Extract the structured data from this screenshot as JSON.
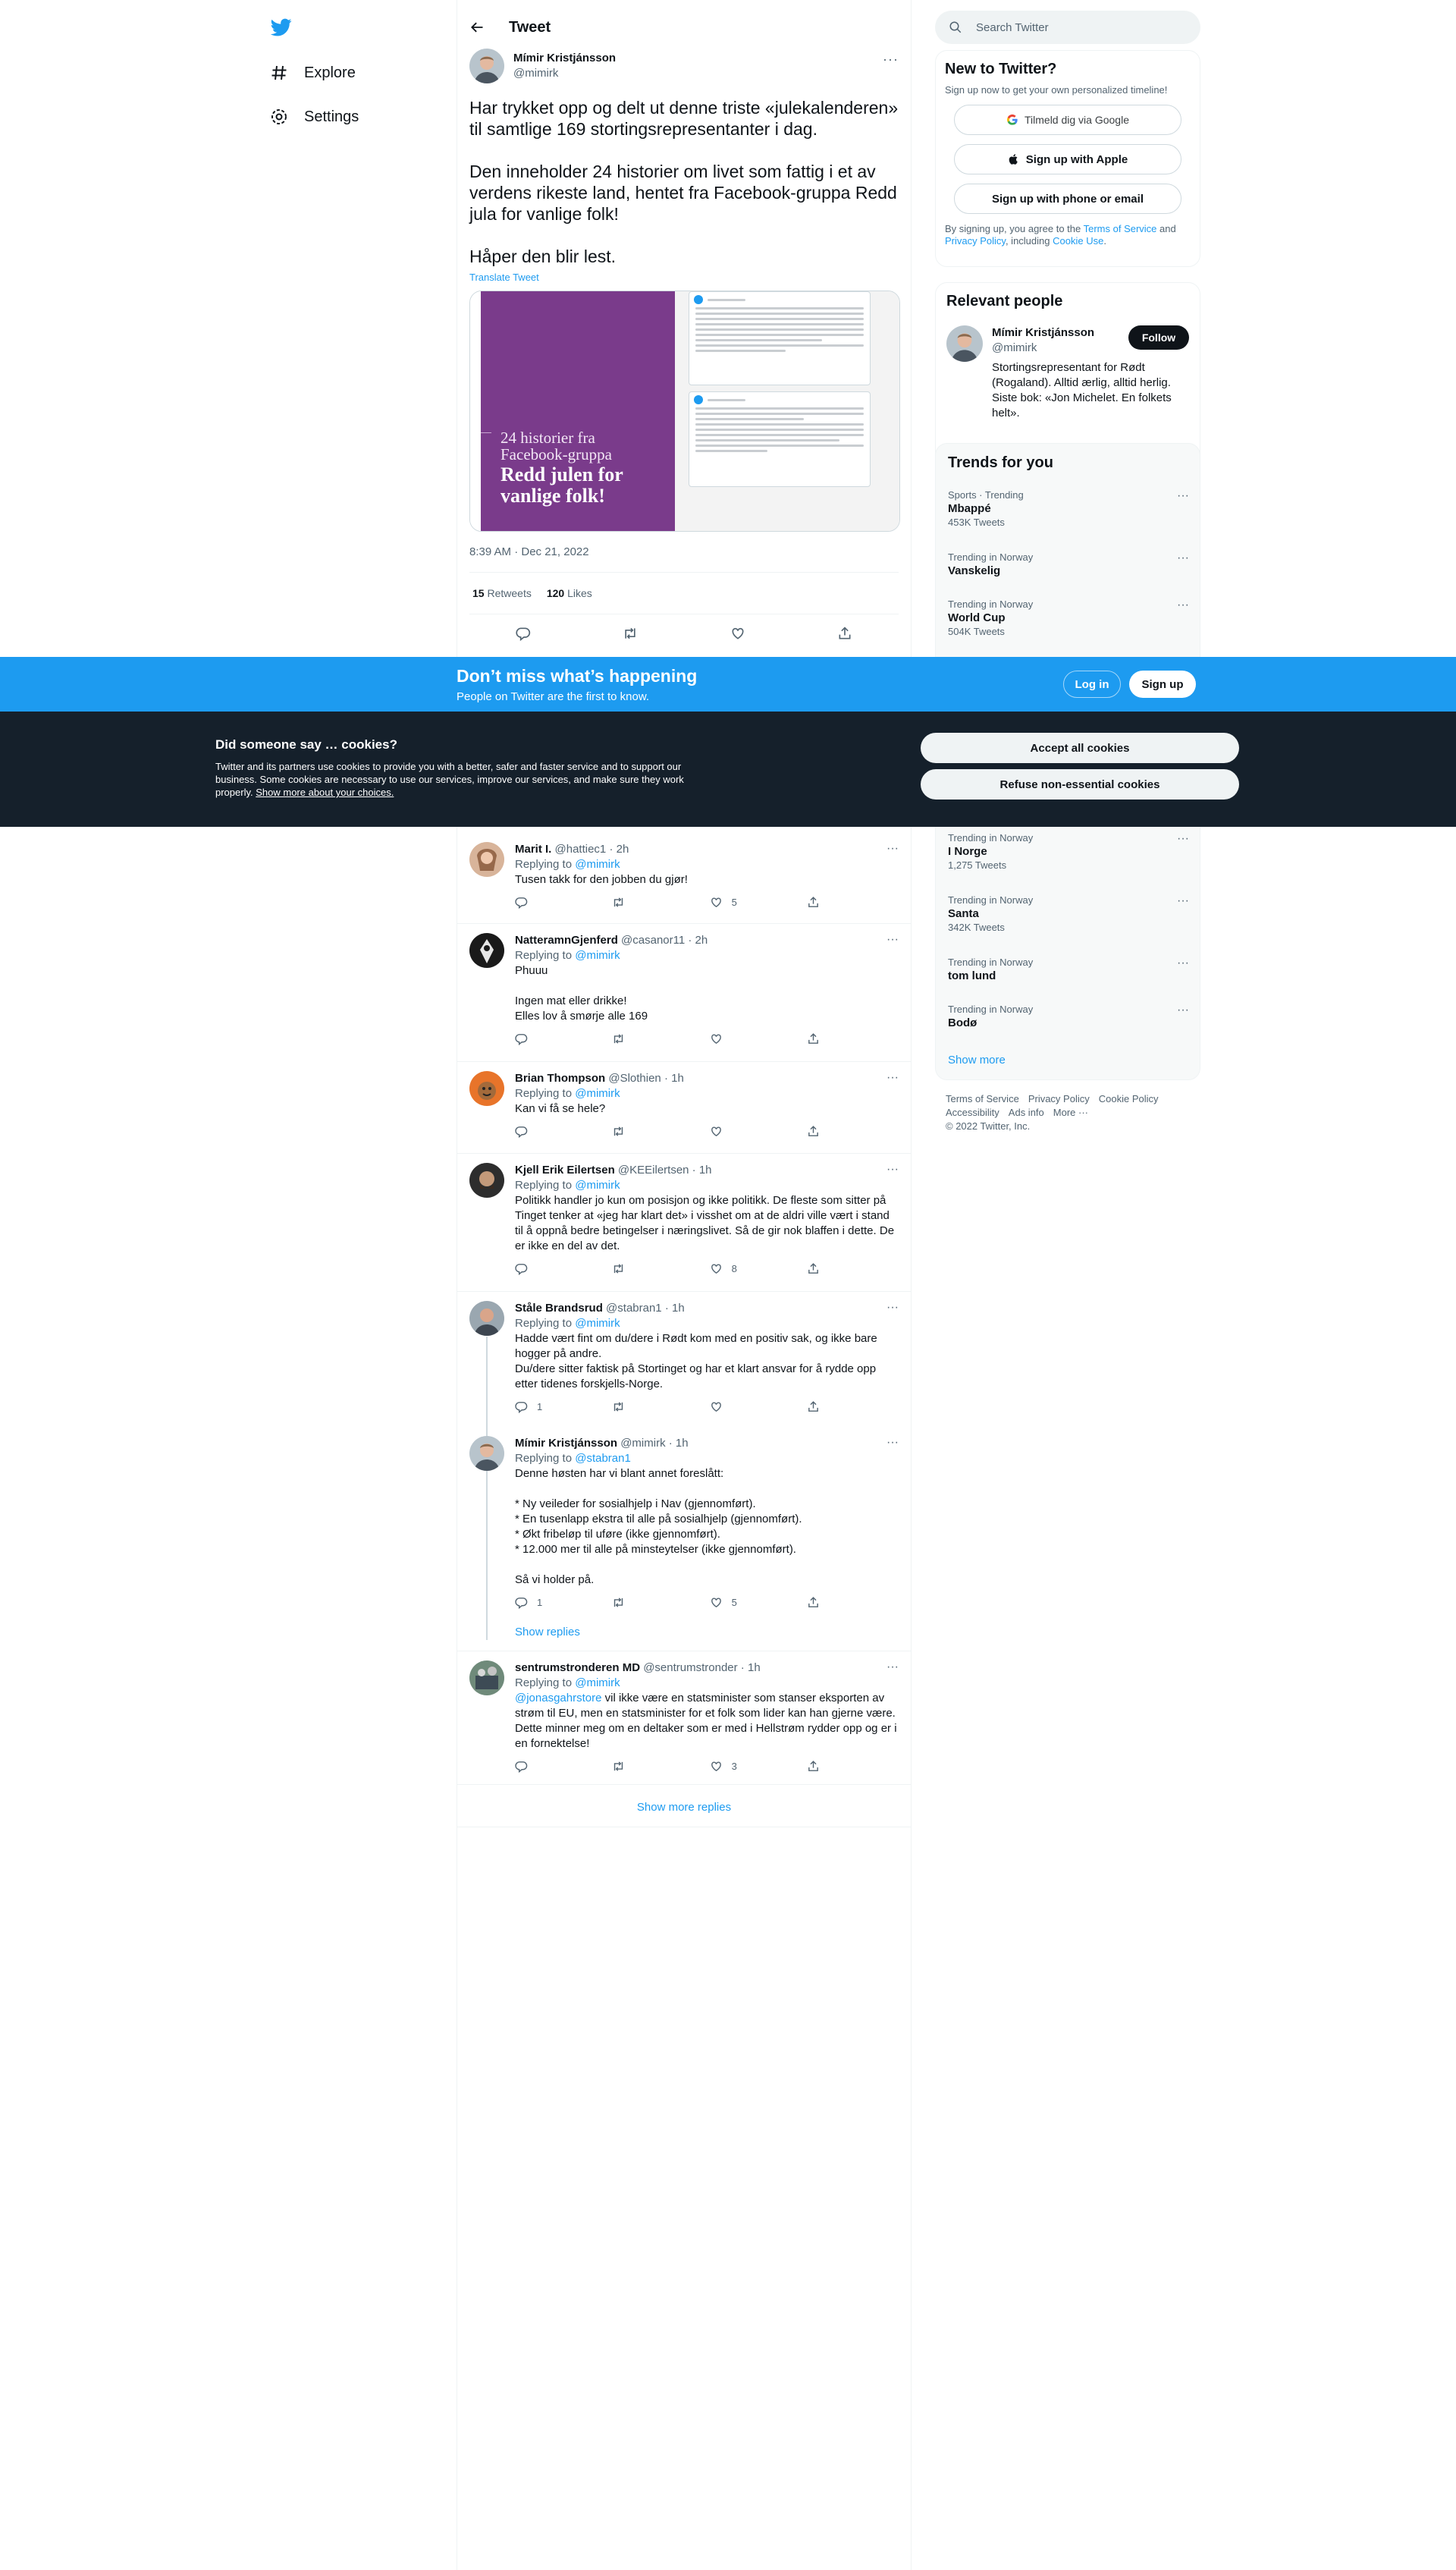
{
  "nav": {
    "logo": "twitter-bird",
    "items": [
      {
        "label": "Explore",
        "icon": "hashtag-icon"
      },
      {
        "label": "Settings",
        "icon": "gear-icon"
      }
    ]
  },
  "header": {
    "title": "Tweet"
  },
  "main_tweet": {
    "author_name": "Mímir Kristjánsson",
    "author_handle": "@mimirk",
    "paragraphs": [
      "Har trykket opp og delt ut denne triste «julekalenderen» til samtlige 169 stortingsrepresentanter i dag.",
      "Den inneholder 24 historier om livet som fattig i et av verdens rikeste land, hentet fra Facebook-gruppa Redd jula for vanlige folk!",
      "Håper den blir lest."
    ],
    "translate": "Translate Tweet",
    "media_sub_line1": "24 historier fra",
    "media_sub_line2": "Facebook-gruppa",
    "media_big_line1": "Redd julen for",
    "media_big_line2": "vanlige folk!",
    "timestamp": "8:39 AM · Dec 21, 2022",
    "retweets_count": "15",
    "retweets_label": "Retweets",
    "likes_count": "120",
    "likes_label": "Likes"
  },
  "replies": [
    {
      "name": "Marit I.",
      "handle": "@hattiec1 · 2h",
      "replying_label": "Replying to",
      "replying_to": "@mimirk",
      "text": "Tusen takk for den jobben du gjør!",
      "reply_count": "",
      "retweet_count": "",
      "like_count": "5"
    },
    {
      "name": "NatteramnGjenferd",
      "handle": "@casanor11 · 2h",
      "replying_label": "Replying to",
      "replying_to": "@mimirk",
      "text": "Phuuu\n\nIngen mat eller drikke!\nElles lov å smørje alle 169",
      "reply_count": "",
      "retweet_count": "",
      "like_count": ""
    },
    {
      "name": "Brian Thompson",
      "handle": "@Slothien · 1h",
      "replying_label": "Replying to",
      "replying_to": "@mimirk",
      "text": "Kan vi få se hele?",
      "reply_count": "",
      "retweet_count": "",
      "like_count": ""
    },
    {
      "name": "Kjell Erik Eilertsen",
      "handle": "@KEEilertsen · 1h",
      "replying_label": "Replying to",
      "replying_to": "@mimirk",
      "text": "Politikk handler jo kun om posisjon og ikke politikk. De fleste som sitter på Tinget tenker at «jeg har klart det» i visshet om at de aldri ville vært i stand til å oppnå bedre betingelser i næringslivet. Så de gir nok blaffen i dette. De er ikke en del av det.",
      "reply_count": "",
      "retweet_count": "",
      "like_count": "8"
    },
    {
      "name": "Ståle Brandsrud",
      "handle": "@stabran1 · 1h",
      "replying_label": "Replying to",
      "replying_to": "@mimirk",
      "text": "Hadde vært fint om du/dere i Rødt kom med en positiv sak, og ikke bare hogger på andre.\nDu/dere sitter faktisk på Stortinget og har et klart ansvar for å rydde opp etter tidenes forskjells-Norge.",
      "reply_count": "1",
      "retweet_count": "",
      "like_count": ""
    },
    {
      "name": "Mímir Kristjánsson",
      "handle": "@mimirk · 1h",
      "replying_label": "Replying to",
      "replying_to": "@stabran1",
      "text": "Denne høsten har vi blant annet foreslått:\n\n* Ny veileder for sosialhjelp i Nav (gjennomført).\n* En tusenlapp ekstra til alle på sosialhjelp (gjennomført).\n* Økt fribeløp til uføre (ikke gjennomført).\n* 12.000 mer til alle på minsteytelser (ikke gjennomført).\n\nSå vi holder på.",
      "reply_count": "1",
      "retweet_count": "",
      "like_count": "5"
    },
    {
      "name": "sentrumstronderen MD",
      "handle": "@sentrumstronder · 1h",
      "replying_label": "Replying to",
      "replying_to": "@mimirk",
      "mention": "@jonasgahrstore",
      "text": " vil ikke være en statsminister som stanser eksporten av strøm til EU, men en statsminister for et folk som lider kan han gjerne være. Dette minner meg om en deltaker som er med i Hellstrøm rydder opp og er i en fornektelse!",
      "reply_count": "",
      "retweet_count": "",
      "like_count": "3"
    }
  ],
  "show_replies": "Show replies",
  "show_more_replies": "Show more replies",
  "sidebar": {
    "search_placeholder": "Search Twitter",
    "new_title": "New to Twitter?",
    "new_sub": "Sign up now to get your own personalized timeline!",
    "google_btn": "Tilmeld dig via Google",
    "apple_btn": "Sign up with Apple",
    "phone_btn": "Sign up with phone or email",
    "legal_1": "By signing up, you agree to the ",
    "legal_tos": "Terms of Service",
    "legal_2": " and ",
    "legal_pp": "Privacy Policy",
    "legal_3": ", including ",
    "legal_cookie": "Cookie Use",
    "legal_4": ".",
    "people_title": "Relevant people",
    "person_name": "Mímir Kristjánsson",
    "person_handle": "@mimirk",
    "follow_label": "Follow",
    "person_bio": "Stortingsrepresentant for Rødt (Rogaland). Alltid ærlig, alltid herlig. Siste bok: «Jon Michelet. En folkets helt».",
    "trends_title": "Trends for you",
    "trends": [
      {
        "meta": "Sports · Trending",
        "name": "Mbappé",
        "count": "453K Tweets"
      },
      {
        "meta": "Trending in Norway",
        "name": "Vanskelig",
        "count": ""
      },
      {
        "meta": "Trending in Norway",
        "name": "World Cup",
        "count": "504K Tweets"
      },
      {
        "meta": "Trending in Norway",
        "name": "I Norge",
        "count": "1,275 Tweets"
      },
      {
        "meta": "Trending in Norway",
        "name": "Santa",
        "count": "342K Tweets"
      },
      {
        "meta": "Trending in Norway",
        "name": "tom lund",
        "count": ""
      },
      {
        "meta": "Trending in Norway",
        "name": "Bodø",
        "count": ""
      }
    ],
    "show_more": "Show more",
    "footer": [
      "Terms of Service",
      "Privacy Policy",
      "Cookie Policy",
      "Accessibility",
      "Ads info",
      "More ···",
      "© 2022 Twitter, Inc."
    ]
  },
  "banner": {
    "title": "Don’t miss what’s happening",
    "sub": "People on Twitter are the first to know.",
    "login": "Log in",
    "signup": "Sign up"
  },
  "cookies": {
    "title": "Did someone say … cookies?",
    "text": "Twitter and its partners use cookies to provide you with a better, safer and faster service and to support our business. Some cookies are necessary to use our services, improve our services, and make sure they work properly. ",
    "link": "Show more about your choices.",
    "accept": "Accept all cookies",
    "refuse": "Refuse non-essential cookies"
  },
  "colors": {
    "accent": "#1d9bf0",
    "cookie_bg": "#15202b",
    "media_purple": "#7a3b8b"
  }
}
